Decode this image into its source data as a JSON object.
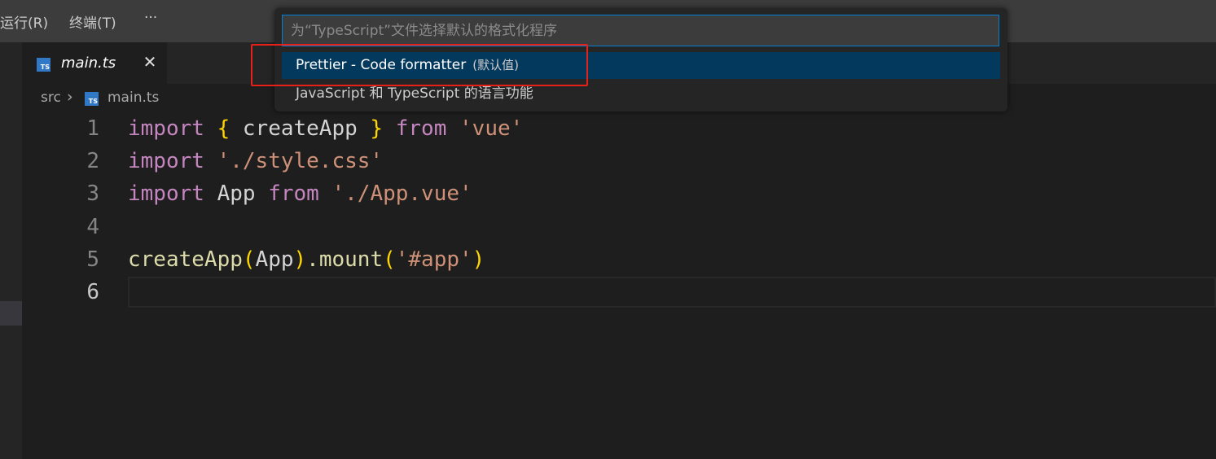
{
  "menu": {
    "run": "运行(R)",
    "terminal": "终端(T)",
    "more": "···"
  },
  "tab": {
    "icon_text": "TS",
    "label": "main.ts",
    "close": "✕"
  },
  "breadcrumb": {
    "folder": "src",
    "separator": "›",
    "file": "main.ts"
  },
  "editor": {
    "lines": [
      {
        "number": "1",
        "tokens": [
          "import",
          " ",
          "{",
          " createApp ",
          "}",
          " ",
          "from",
          " ",
          "'vue'"
        ]
      },
      {
        "number": "2",
        "tokens": [
          "import",
          " ",
          "'./style.css'"
        ]
      },
      {
        "number": "3",
        "tokens": [
          "import",
          " App ",
          "from",
          " ",
          "'./App.vue'"
        ]
      },
      {
        "number": "4",
        "tokens": []
      },
      {
        "number": "5",
        "tokens": [
          "createApp",
          "(",
          "App",
          ")",
          ".mount",
          "(",
          "'#app'",
          ")"
        ]
      },
      {
        "number": "6",
        "tokens": []
      }
    ],
    "active_line": "6"
  },
  "quick_pick": {
    "placeholder": "为“TypeScript”文件选择默认的格式化程序",
    "items": [
      {
        "label": "Prettier - Code formatter",
        "description": "(默认值)",
        "selected": true
      },
      {
        "label": "JavaScript 和 TypeScript 的语言功能",
        "description": "",
        "selected": false
      }
    ]
  },
  "colors": {
    "accent": "#007fd4",
    "selection": "#04395e",
    "annotation_box": "#e8201a"
  }
}
